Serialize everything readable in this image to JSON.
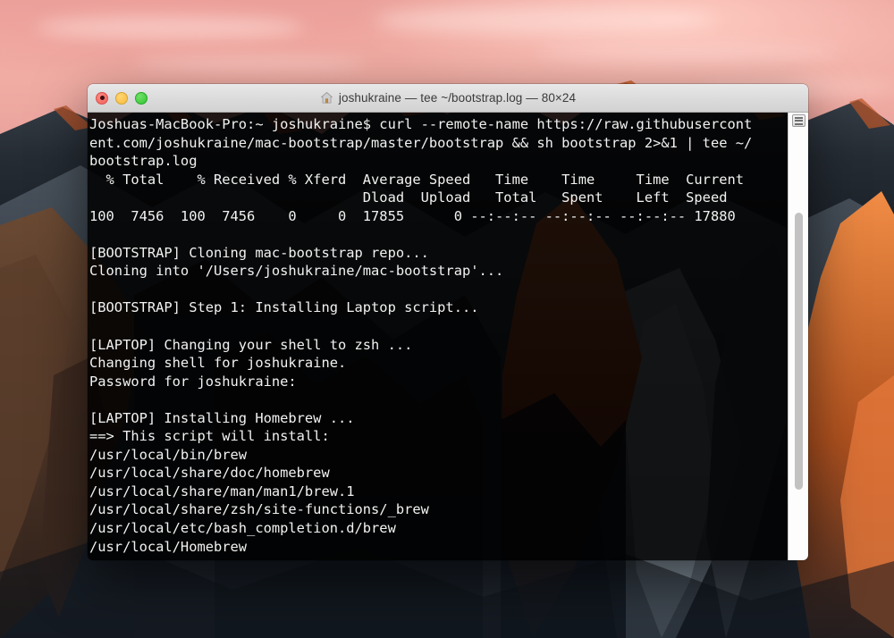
{
  "desktop": {
    "wallpaper_name": "macos-sierra-wallpaper",
    "sky_color": "#efa8a0",
    "rock_color": "#2b323a",
    "alpenglow_color": "#c3592b"
  },
  "window": {
    "app": "Terminal",
    "title": "joshukraine — tee ~/bootstrap.log — 80×24",
    "home_icon": "home-icon",
    "traffic_lights": {
      "close_label": "Close",
      "minimize_label": "Minimize",
      "maximize_label": "Zoom",
      "close_color": "#f2615d",
      "minimize_color": "#f7bc3d",
      "maximize_color": "#31c52f"
    },
    "columns": 80,
    "rows": 24,
    "scrollbar": {
      "split_pane_button_label": "Split Pane",
      "thumb_label": "Scrollbar Thumb"
    }
  },
  "terminal": {
    "foreground_color": "#f2f2f2",
    "background_color": "rgba(0,0,0,0.87)",
    "lines": [
      "Joshuas-MacBook-Pro:~ joshukraine$ curl --remote-name https://raw.githubusercont",
      "ent.com/joshukraine/mac-bootstrap/master/bootstrap && sh bootstrap 2>&1 | tee ~/",
      "bootstrap.log",
      "  % Total    % Received % Xferd  Average Speed   Time    Time     Time  Current",
      "                                 Dload  Upload   Total   Spent    Left  Speed",
      "100  7456  100  7456    0     0  17855      0 --:--:-- --:--:-- --:--:-- 17880",
      "",
      "[BOOTSTRAP] Cloning mac-bootstrap repo...",
      "Cloning into '/Users/joshukraine/mac-bootstrap'...",
      "",
      "[BOOTSTRAP] Step 1: Installing Laptop script...",
      "",
      "[LAPTOP] Changing your shell to zsh ...",
      "Changing shell for joshukraine.",
      "Password for joshukraine:",
      "",
      "[LAPTOP] Installing Homebrew ...",
      "==> This script will install:",
      "/usr/local/bin/brew",
      "/usr/local/share/doc/homebrew",
      "/usr/local/share/man/man1/brew.1",
      "/usr/local/share/zsh/site-functions/_brew",
      "/usr/local/etc/bash_completion.d/brew",
      "/usr/local/Homebrew"
    ]
  }
}
